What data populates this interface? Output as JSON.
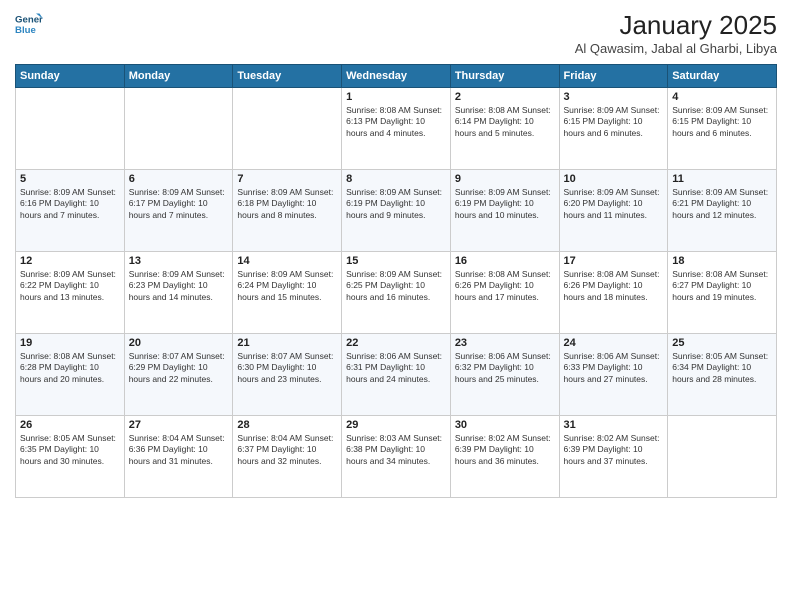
{
  "logo": {
    "line1": "General",
    "line2": "Blue"
  },
  "header": {
    "title": "January 2025",
    "subtitle": "Al Qawasim, Jabal al Gharbi, Libya"
  },
  "weekdays": [
    "Sunday",
    "Monday",
    "Tuesday",
    "Wednesday",
    "Thursday",
    "Friday",
    "Saturday"
  ],
  "weeks": [
    [
      {
        "day": "",
        "detail": ""
      },
      {
        "day": "",
        "detail": ""
      },
      {
        "day": "",
        "detail": ""
      },
      {
        "day": "1",
        "detail": "Sunrise: 8:08 AM\nSunset: 6:13 PM\nDaylight: 10 hours\nand 4 minutes."
      },
      {
        "day": "2",
        "detail": "Sunrise: 8:08 AM\nSunset: 6:14 PM\nDaylight: 10 hours\nand 5 minutes."
      },
      {
        "day": "3",
        "detail": "Sunrise: 8:09 AM\nSunset: 6:15 PM\nDaylight: 10 hours\nand 6 minutes."
      },
      {
        "day": "4",
        "detail": "Sunrise: 8:09 AM\nSunset: 6:15 PM\nDaylight: 10 hours\nand 6 minutes."
      }
    ],
    [
      {
        "day": "5",
        "detail": "Sunrise: 8:09 AM\nSunset: 6:16 PM\nDaylight: 10 hours\nand 7 minutes."
      },
      {
        "day": "6",
        "detail": "Sunrise: 8:09 AM\nSunset: 6:17 PM\nDaylight: 10 hours\nand 7 minutes."
      },
      {
        "day": "7",
        "detail": "Sunrise: 8:09 AM\nSunset: 6:18 PM\nDaylight: 10 hours\nand 8 minutes."
      },
      {
        "day": "8",
        "detail": "Sunrise: 8:09 AM\nSunset: 6:19 PM\nDaylight: 10 hours\nand 9 minutes."
      },
      {
        "day": "9",
        "detail": "Sunrise: 8:09 AM\nSunset: 6:19 PM\nDaylight: 10 hours\nand 10 minutes."
      },
      {
        "day": "10",
        "detail": "Sunrise: 8:09 AM\nSunset: 6:20 PM\nDaylight: 10 hours\nand 11 minutes."
      },
      {
        "day": "11",
        "detail": "Sunrise: 8:09 AM\nSunset: 6:21 PM\nDaylight: 10 hours\nand 12 minutes."
      }
    ],
    [
      {
        "day": "12",
        "detail": "Sunrise: 8:09 AM\nSunset: 6:22 PM\nDaylight: 10 hours\nand 13 minutes."
      },
      {
        "day": "13",
        "detail": "Sunrise: 8:09 AM\nSunset: 6:23 PM\nDaylight: 10 hours\nand 14 minutes."
      },
      {
        "day": "14",
        "detail": "Sunrise: 8:09 AM\nSunset: 6:24 PM\nDaylight: 10 hours\nand 15 minutes."
      },
      {
        "day": "15",
        "detail": "Sunrise: 8:09 AM\nSunset: 6:25 PM\nDaylight: 10 hours\nand 16 minutes."
      },
      {
        "day": "16",
        "detail": "Sunrise: 8:08 AM\nSunset: 6:26 PM\nDaylight: 10 hours\nand 17 minutes."
      },
      {
        "day": "17",
        "detail": "Sunrise: 8:08 AM\nSunset: 6:26 PM\nDaylight: 10 hours\nand 18 minutes."
      },
      {
        "day": "18",
        "detail": "Sunrise: 8:08 AM\nSunset: 6:27 PM\nDaylight: 10 hours\nand 19 minutes."
      }
    ],
    [
      {
        "day": "19",
        "detail": "Sunrise: 8:08 AM\nSunset: 6:28 PM\nDaylight: 10 hours\nand 20 minutes."
      },
      {
        "day": "20",
        "detail": "Sunrise: 8:07 AM\nSunset: 6:29 PM\nDaylight: 10 hours\nand 22 minutes."
      },
      {
        "day": "21",
        "detail": "Sunrise: 8:07 AM\nSunset: 6:30 PM\nDaylight: 10 hours\nand 23 minutes."
      },
      {
        "day": "22",
        "detail": "Sunrise: 8:06 AM\nSunset: 6:31 PM\nDaylight: 10 hours\nand 24 minutes."
      },
      {
        "day": "23",
        "detail": "Sunrise: 8:06 AM\nSunset: 6:32 PM\nDaylight: 10 hours\nand 25 minutes."
      },
      {
        "day": "24",
        "detail": "Sunrise: 8:06 AM\nSunset: 6:33 PM\nDaylight: 10 hours\nand 27 minutes."
      },
      {
        "day": "25",
        "detail": "Sunrise: 8:05 AM\nSunset: 6:34 PM\nDaylight: 10 hours\nand 28 minutes."
      }
    ],
    [
      {
        "day": "26",
        "detail": "Sunrise: 8:05 AM\nSunset: 6:35 PM\nDaylight: 10 hours\nand 30 minutes."
      },
      {
        "day": "27",
        "detail": "Sunrise: 8:04 AM\nSunset: 6:36 PM\nDaylight: 10 hours\nand 31 minutes."
      },
      {
        "day": "28",
        "detail": "Sunrise: 8:04 AM\nSunset: 6:37 PM\nDaylight: 10 hours\nand 32 minutes."
      },
      {
        "day": "29",
        "detail": "Sunrise: 8:03 AM\nSunset: 6:38 PM\nDaylight: 10 hours\nand 34 minutes."
      },
      {
        "day": "30",
        "detail": "Sunrise: 8:02 AM\nSunset: 6:39 PM\nDaylight: 10 hours\nand 36 minutes."
      },
      {
        "day": "31",
        "detail": "Sunrise: 8:02 AM\nSunset: 6:39 PM\nDaylight: 10 hours\nand 37 minutes."
      },
      {
        "day": "",
        "detail": ""
      }
    ]
  ]
}
